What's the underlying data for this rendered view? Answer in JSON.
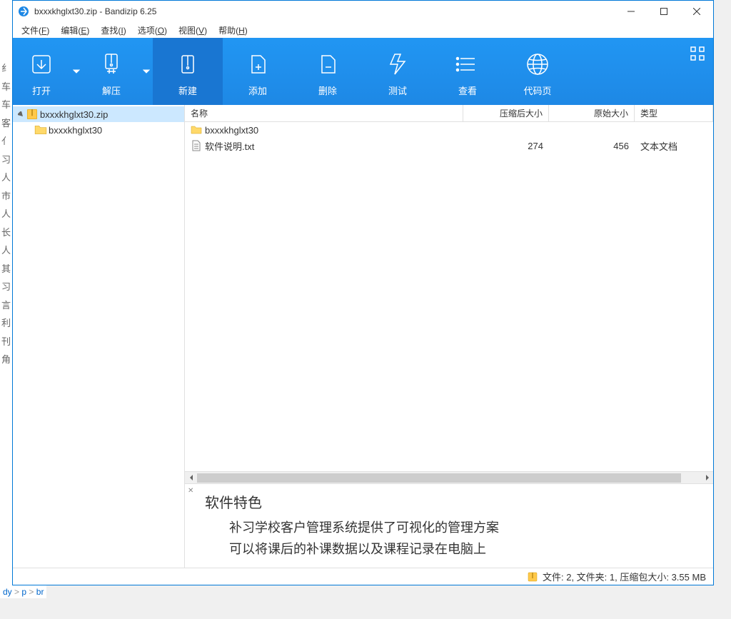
{
  "left_strip": [
    "纟",
    "车",
    "车",
    "",
    "客",
    "",
    "亻",
    "",
    "习",
    "人",
    "市",
    "人",
    "长",
    "人",
    "其",
    "习",
    "言",
    "",
    "利",
    "",
    "刊",
    "角"
  ],
  "window": {
    "title": "bxxxkhglxt30.zip - Bandizip 6.25"
  },
  "menu": [
    {
      "label": "文件",
      "key": "F"
    },
    {
      "label": "编辑",
      "key": "E"
    },
    {
      "label": "查找",
      "key": "I"
    },
    {
      "label": "选项",
      "key": "O"
    },
    {
      "label": "视图",
      "key": "V"
    },
    {
      "label": "帮助",
      "key": "H"
    }
  ],
  "toolbar": [
    {
      "id": "open",
      "label": "打开",
      "arrow": true
    },
    {
      "id": "extract",
      "label": "解压",
      "arrow": true
    },
    {
      "id": "new",
      "label": "新建",
      "active": true
    },
    {
      "id": "add",
      "label": "添加"
    },
    {
      "id": "delete",
      "label": "删除"
    },
    {
      "id": "test",
      "label": "测试"
    },
    {
      "id": "view",
      "label": "查看"
    },
    {
      "id": "codepage",
      "label": "代码页"
    }
  ],
  "tree": {
    "root": "bxxxkhglxt30.zip",
    "child": "bxxxkhglxt30"
  },
  "columns": {
    "name": "名称",
    "compressed": "压缩后大小",
    "original": "原始大小",
    "type": "类型"
  },
  "rows": [
    {
      "name": "bxxxkhglxt30",
      "compressed": "",
      "original": "",
      "type": "",
      "icon": "folder"
    },
    {
      "name": "软件说明.txt",
      "compressed": "274",
      "original": "456",
      "type": "文本文档",
      "icon": "txt"
    }
  ],
  "preview": {
    "title": "软件特色",
    "lines": [
      "补习学校客户管理系统提供了可视化的管理方案",
      "可以将课后的补课数据以及课程记录在电脑上"
    ]
  },
  "statusbar": "文件: 2, 文件夹: 1, 压缩包大小: 3.55 MB",
  "crumb": {
    "a": "dy",
    "b": "p",
    "c": "br"
  }
}
